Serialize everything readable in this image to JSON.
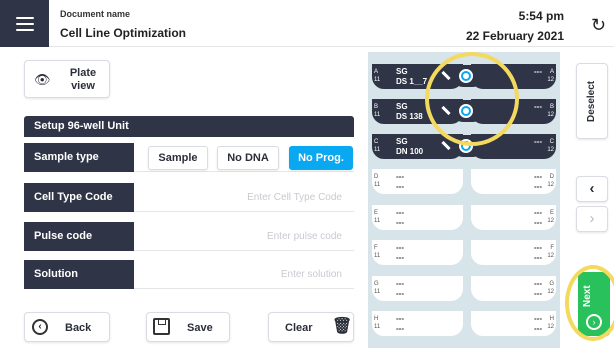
{
  "header": {
    "doc_label": "Document name",
    "doc_title": "Cell Line Optimization",
    "time": "5:54 pm",
    "date": "22 February 2021",
    "menu_icon": "hamburger-icon",
    "sync_icon": "sync-icon"
  },
  "plate_view": {
    "label": "Plate view",
    "icon": "eye-icon"
  },
  "setup": {
    "title": "Setup 96-well Unit"
  },
  "sample_type": {
    "label": "Sample type",
    "options": [
      "Sample",
      "No DNA",
      "No Prog."
    ],
    "selected": "No Prog."
  },
  "cell_type": {
    "label": "Cell Type Code",
    "placeholder": "Enter Cell Type Code"
  },
  "pulse": {
    "label": "Pulse code",
    "placeholder": "Enter pulse code"
  },
  "solution": {
    "label": "Solution",
    "placeholder": "Enter solution"
  },
  "bottom": {
    "back": "Back",
    "save": "Save",
    "clear": "Clear"
  },
  "wells": [
    {
      "row": "A",
      "col_l": "11",
      "col_r": "12",
      "top": "SG",
      "bottom": "DS 1__7",
      "right": "---",
      "selected": true
    },
    {
      "row": "B",
      "col_l": "11",
      "col_r": "12",
      "top": "SG",
      "bottom": "DS 138",
      "right": "---",
      "selected": true
    },
    {
      "row": "C",
      "col_l": "11",
      "col_r": "12",
      "top": "SG",
      "bottom": "DN 100",
      "right": "---",
      "selected": true
    },
    {
      "row": "D",
      "col_l": "11",
      "col_r": "12",
      "top": "---",
      "bottom": "---",
      "right": "---",
      "selected": false
    },
    {
      "row": "E",
      "col_l": "11",
      "col_r": "12",
      "top": "---",
      "bottom": "---",
      "right": "---",
      "selected": false
    },
    {
      "row": "F",
      "col_l": "11",
      "col_r": "12",
      "top": "---",
      "bottom": "---",
      "right": "---",
      "selected": false
    },
    {
      "row": "G",
      "col_l": "11",
      "col_r": "12",
      "top": "---",
      "bottom": "---",
      "right": "---",
      "selected": false
    },
    {
      "row": "H",
      "col_l": "11",
      "col_r": "12",
      "top": "---",
      "bottom": "---",
      "right": "---",
      "selected": false
    }
  ],
  "side": {
    "deselect": "Deselect",
    "prev_icon": "chevron-left-icon",
    "next_icon": "chevron-right-icon",
    "next_label": "Next"
  },
  "colors": {
    "dark": "#2f3546",
    "accent": "#0aa8f0",
    "green": "#28c15b",
    "highlight": "#f3d95e",
    "panel": "#d7e4ea"
  }
}
